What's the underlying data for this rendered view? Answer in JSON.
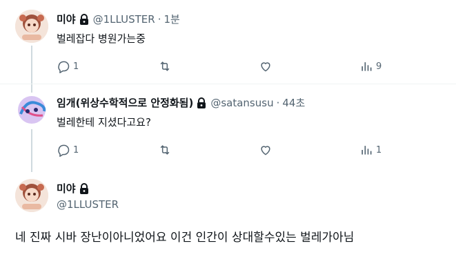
{
  "tweets": [
    {
      "name": "미야",
      "handle": "@1LLUSTER",
      "time": "1분",
      "text": "벌레잡다 병원가는중",
      "replies": "1",
      "views": "9"
    },
    {
      "name": "임개(위상수학적으로 안정화됨)",
      "handle": "@satansusu",
      "time": "44초",
      "text": "벌레한테 지셨다고요?",
      "replies": "1",
      "views": "1"
    }
  ],
  "main": {
    "name": "미야",
    "handle": "@1LLUSTER",
    "text": "네 진짜 시바 장난이아니었어요 이건 인간이 상대할수있는 벌레가아님"
  },
  "separator": "·",
  "colors": {
    "text": "#0f1419",
    "secondary": "#536471",
    "line": "#cfd9de"
  }
}
